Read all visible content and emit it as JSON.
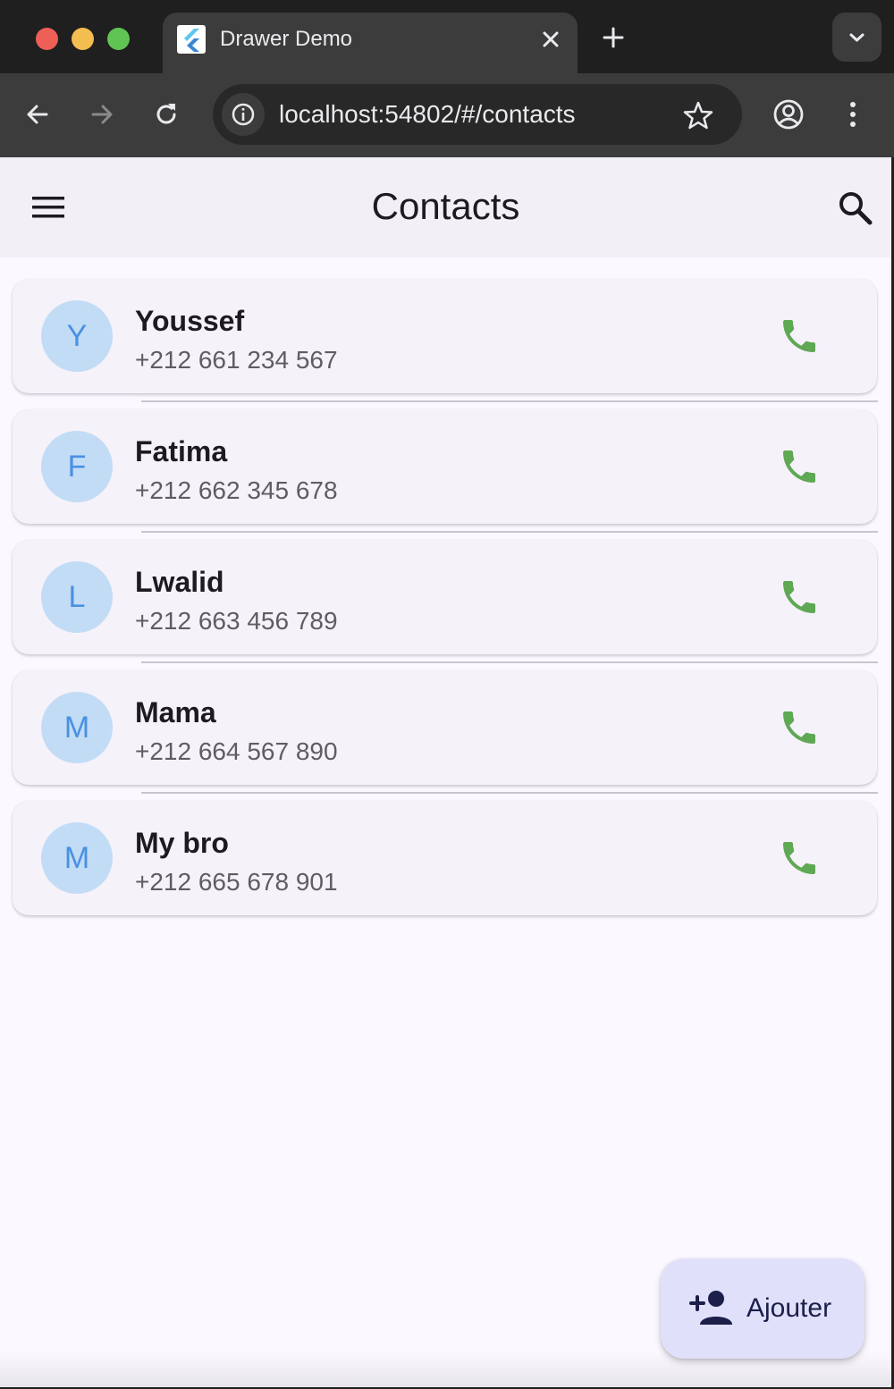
{
  "browser": {
    "tab_title": "Drawer Demo",
    "url": "localhost:54802/#/contacts"
  },
  "appbar": {
    "title": "Contacts"
  },
  "contacts": [
    {
      "initial": "Y",
      "name": "Youssef",
      "phone": "+212 661 234 567"
    },
    {
      "initial": "F",
      "name": "Fatima",
      "phone": "+212 662 345 678"
    },
    {
      "initial": "L",
      "name": "Lwalid",
      "phone": "+212 663 456 789"
    },
    {
      "initial": "M",
      "name": "Mama",
      "phone": "+212 664 567 890"
    },
    {
      "initial": "M",
      "name": "My bro",
      "phone": "+212 665 678 901"
    }
  ],
  "fab": {
    "label": "Ajouter"
  },
  "colors": {
    "call_icon": "#5fa854",
    "avatar_bg": "#c2dcf6",
    "avatar_text": "#4a90e2",
    "fab_bg": "#e1e0fa"
  }
}
